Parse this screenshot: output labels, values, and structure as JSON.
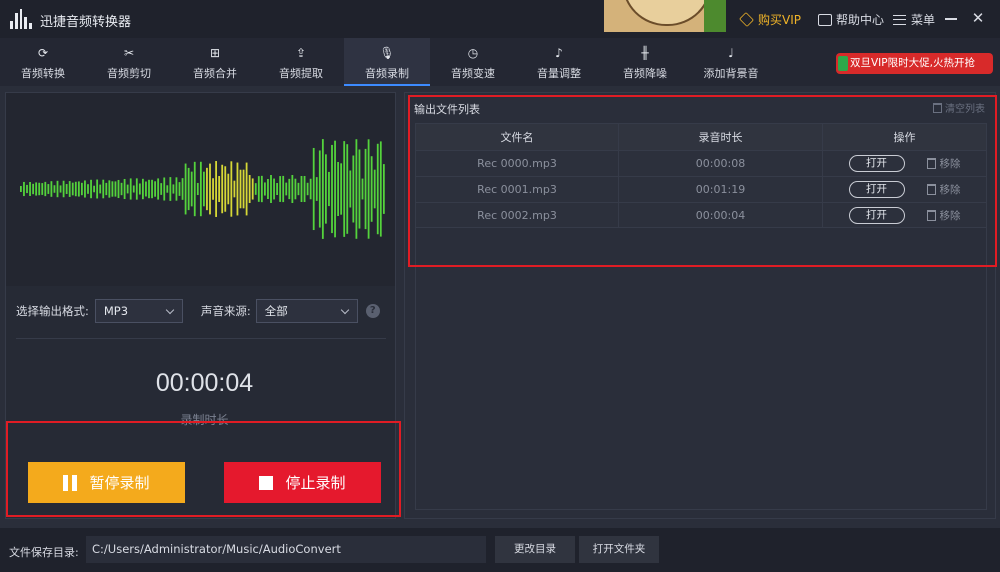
{
  "app": {
    "title": "迅捷音频转换器"
  },
  "titlebar": {
    "vip": "购买VIP",
    "help": "帮助中心",
    "menu": "菜单"
  },
  "tabs": [
    {
      "label": "音频转换",
      "icon": "convert-icon"
    },
    {
      "label": "音频剪切",
      "icon": "scissors-icon"
    },
    {
      "label": "音频合并",
      "icon": "merge-icon"
    },
    {
      "label": "音频提取",
      "icon": "extract-icon"
    },
    {
      "label": "音频录制",
      "icon": "microphone-icon",
      "active": true
    },
    {
      "label": "音频变速",
      "icon": "speed-icon"
    },
    {
      "label": "音量调整",
      "icon": "volume-icon"
    },
    {
      "label": "音频降噪",
      "icon": "denoise-icon"
    },
    {
      "label": "添加背景音",
      "icon": "music-icon"
    }
  ],
  "promo": {
    "text": "双旦VIP限时大促,火热开抢"
  },
  "recorder": {
    "format_label": "选择输出格式:",
    "format_value": "MP3",
    "source_label": "声音来源:",
    "source_value": "全部",
    "timer": "00:00:04",
    "timer_label": "录制时长",
    "pause_label": "暂停录制",
    "stop_label": "停止录制"
  },
  "output": {
    "title": "输出文件列表",
    "clear": "清空列表",
    "headers": [
      "文件名",
      "录音时长",
      "操作"
    ],
    "open_label": "打开",
    "remove_label": "移除",
    "rows": [
      {
        "name": "Rec 0000.mp3",
        "duration": "00:00:08"
      },
      {
        "name": "Rec 0001.mp3",
        "duration": "00:01:19"
      },
      {
        "name": "Rec 0002.mp3",
        "duration": "00:00:04"
      }
    ]
  },
  "footer": {
    "save_label": "文件保存目录:",
    "path": "C:/Users/Administrator/Music/AudioConvert",
    "change_dir": "更改目录",
    "open_folder": "打开文件夹"
  },
  "colors": {
    "accent": "#3d8bff",
    "pause": "#f4aa1c",
    "stop": "#e5192d",
    "wave_green": "#54d33c",
    "wave_yellow": "#d6d836",
    "annotation": "#e01c24"
  }
}
